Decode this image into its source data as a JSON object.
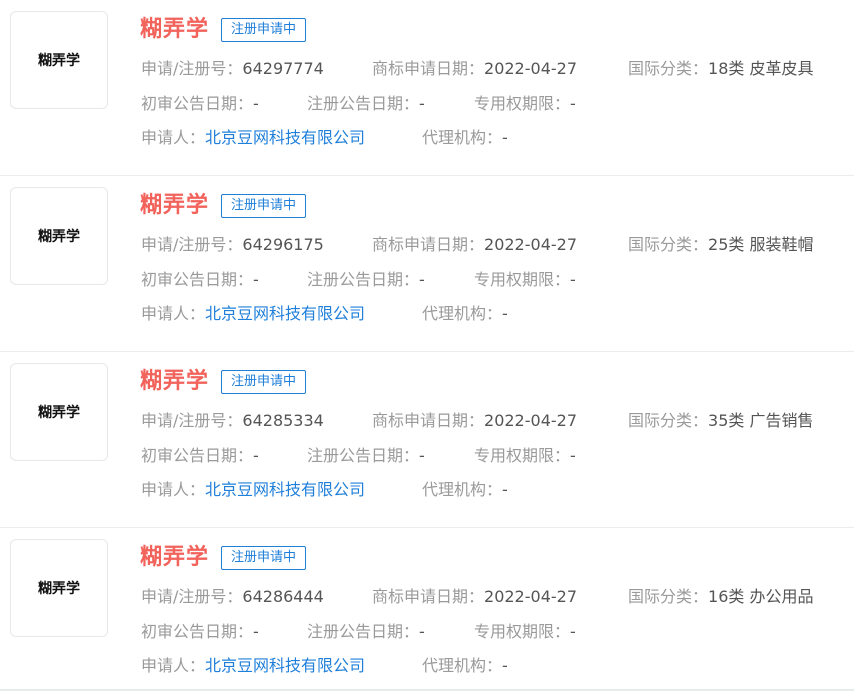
{
  "labels": {
    "reg_no": "申请/注册号：",
    "apply_date": "商标申请日期：",
    "intl_class": "国际分类：",
    "prelim_date": "初审公告日期：",
    "reg_date": "注册公告日期：",
    "exclusive_period": "专用权期限：",
    "applicant": "申请人：",
    "agency": "代理机构："
  },
  "items": [
    {
      "logo_text": "糊弄学",
      "name": "糊弄学",
      "status": "注册申请中",
      "reg_no": "64297774",
      "apply_date": "2022-04-27",
      "intl_class": "18类 皮革皮具",
      "prelim_date": "-",
      "reg_date": "-",
      "exclusive_period": "-",
      "applicant": "北京豆网科技有限公司",
      "agency": "-"
    },
    {
      "logo_text": "糊弄学",
      "name": "糊弄学",
      "status": "注册申请中",
      "reg_no": "64296175",
      "apply_date": "2022-04-27",
      "intl_class": "25类 服装鞋帽",
      "prelim_date": "-",
      "reg_date": "-",
      "exclusive_period": "-",
      "applicant": "北京豆网科技有限公司",
      "agency": "-"
    },
    {
      "logo_text": "糊弄学",
      "name": "糊弄学",
      "status": "注册申请中",
      "reg_no": "64285334",
      "apply_date": "2022-04-27",
      "intl_class": "35类 广告销售",
      "prelim_date": "-",
      "reg_date": "-",
      "exclusive_period": "-",
      "applicant": "北京豆网科技有限公司",
      "agency": "-"
    },
    {
      "logo_text": "糊弄学",
      "name": "糊弄学",
      "status": "注册申请中",
      "reg_no": "64286444",
      "apply_date": "2022-04-27",
      "intl_class": "16类 办公用品",
      "prelim_date": "-",
      "reg_date": "-",
      "exclusive_period": "-",
      "applicant": "北京豆网科技有限公司",
      "agency": "-"
    }
  ],
  "colors": {
    "name": "#f2635c",
    "badge": "#1f7fd9",
    "link": "#1f7fd9",
    "label": "#9a9a9a",
    "value": "#555555"
  }
}
